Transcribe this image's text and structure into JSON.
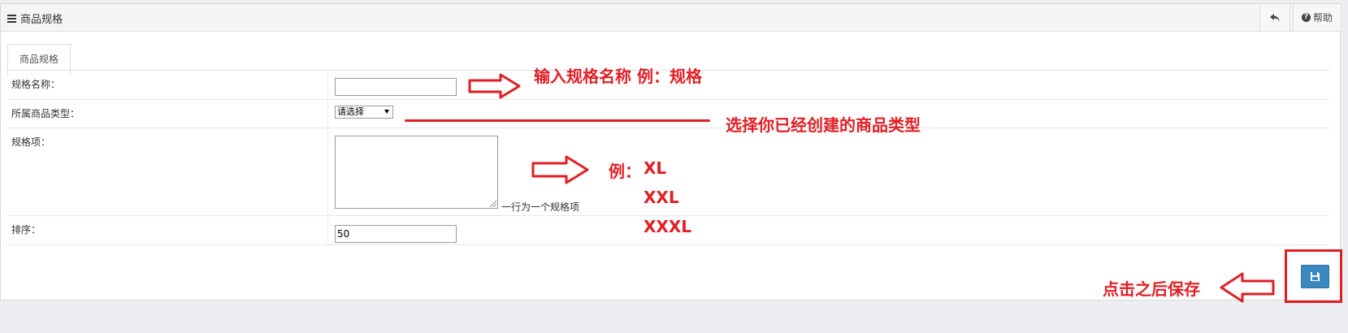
{
  "header": {
    "title": "商品规格",
    "help_label": "帮助"
  },
  "tabs": [
    {
      "label": "商品规格"
    }
  ],
  "form": {
    "name_label": "规格名称：",
    "name_value": "",
    "type_label": "所属商品类型：",
    "type_selected": "请选择",
    "items_label": "规格项：",
    "items_value": "",
    "items_hint": "一行为一个规格项",
    "sort_label": "排序：",
    "sort_value": "50"
  },
  "annotations": {
    "name_note": "输入规格名称  例：规格",
    "type_note": "选择你已经创建的商品类型",
    "items_note_prefix": "例：",
    "items_examples": [
      "XL",
      "XXL",
      "XXXL"
    ],
    "save_note": "点击之后保存"
  },
  "icons": {
    "title": "list-icon",
    "back": "reply-icon",
    "help": "question-circle-icon",
    "save": "floppy-disk-icon"
  },
  "colors": {
    "accent": "#3a88c0",
    "annotation": "#e21e25"
  }
}
